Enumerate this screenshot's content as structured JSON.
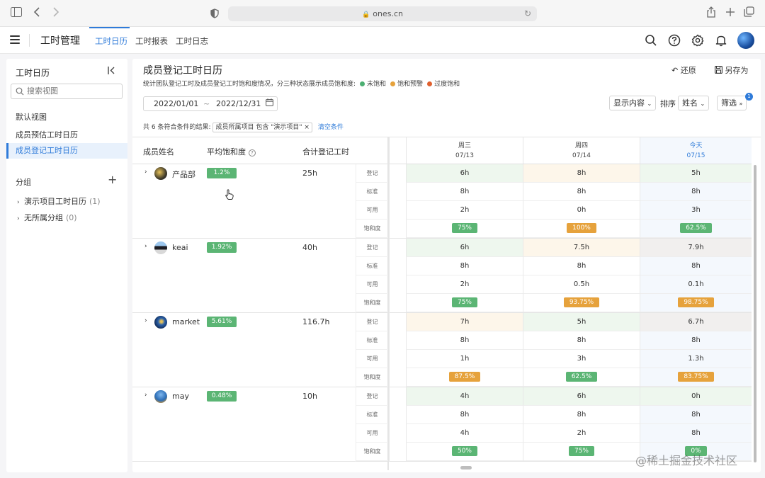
{
  "browser": {
    "url": "ones.cn"
  },
  "header": {
    "app_title": "工时管理",
    "tabs": [
      {
        "label": "工时日历",
        "active": true
      },
      {
        "label": "工时报表"
      },
      {
        "label": "工时日志"
      }
    ]
  },
  "sidebar": {
    "title": "工时日历",
    "search_placeholder": "搜索视图",
    "default_section": "默认视图",
    "views": [
      {
        "label": "成员预估工时日历"
      },
      {
        "label": "成员登记工时日历",
        "active": true
      }
    ],
    "group_section": "分组",
    "groups": [
      {
        "label": "演示项目工时日历",
        "count": "(1)"
      },
      {
        "label": "无所属分组",
        "count": "(0)"
      }
    ]
  },
  "main": {
    "title": "成员登记工时日历",
    "description": "统计团队登记工时及成员登记工时饱和度情况，分三种状态展示成员饱和度:",
    "legend": [
      {
        "label": "未饱和",
        "color": "#4caf72"
      },
      {
        "label": "饱和预警",
        "color": "#e6a23c"
      },
      {
        "label": "过度饱和",
        "color": "#e0602e"
      }
    ],
    "restore_label": "还原",
    "save_as_label": "另存为",
    "date_start": "2022/01/01",
    "date_sep": "~",
    "date_end": "2022/12/31",
    "display_label": "显示内容",
    "sort_label": "排序",
    "sort_value": "姓名",
    "filter_label": "筛选",
    "filter_badge": "1",
    "result_text": "共 6 条符合条件的结果:",
    "condition_tag": "成员所属项目 包含 \"演示项目\"",
    "clear_label": "清空条件"
  },
  "table": {
    "col_name": "成员姓名",
    "col_avg": "平均饱和度",
    "col_total": "合计登记工时",
    "row_labels": [
      "登记",
      "标准",
      "可用",
      "饱和度"
    ],
    "days": [
      {
        "weekday": "周三",
        "date": "07/13"
      },
      {
        "weekday": "周四",
        "date": "07/14"
      },
      {
        "weekday": "今天",
        "date": "07/15",
        "today": true
      }
    ],
    "members": [
      {
        "name": "产品部",
        "avg": "1.2%",
        "total": "25h",
        "caret": "›",
        "days": [
          {
            "logged": "6h",
            "standard": "8h",
            "available": "2h",
            "sat": "75%",
            "level": "g",
            "bg": "bg-g"
          },
          {
            "logged": "8h",
            "standard": "8h",
            "available": "0h",
            "sat": "100%",
            "level": "o",
            "bg": "bg-o"
          },
          {
            "logged": "5h",
            "standard": "8h",
            "available": "3h",
            "sat": "62.5%",
            "level": "g",
            "bg": "bg-g"
          }
        ]
      },
      {
        "name": "keai",
        "avg": "1.92%",
        "total": "40h",
        "caret": "›",
        "days": [
          {
            "logged": "6h",
            "standard": "8h",
            "available": "2h",
            "sat": "75%",
            "level": "g",
            "bg": "bg-g"
          },
          {
            "logged": "7.5h",
            "standard": "8h",
            "available": "0.5h",
            "sat": "93.75%",
            "level": "o",
            "bg": "bg-o"
          },
          {
            "logged": "7.9h",
            "standard": "8h",
            "available": "0.1h",
            "sat": "98.75%",
            "level": "o",
            "bg": "bg-gray"
          }
        ]
      },
      {
        "name": "market",
        "avg": "5.61%",
        "total": "116.7h",
        "caret": "›",
        "days": [
          {
            "logged": "7h",
            "standard": "8h",
            "available": "1h",
            "sat": "87.5%",
            "level": "o",
            "bg": "bg-o"
          },
          {
            "logged": "5h",
            "standard": "8h",
            "available": "3h",
            "sat": "62.5%",
            "level": "g",
            "bg": "bg-g"
          },
          {
            "logged": "6.7h",
            "standard": "8h",
            "available": "1.3h",
            "sat": "83.75%",
            "level": "o",
            "bg": "bg-gray"
          }
        ]
      },
      {
        "name": "may",
        "avg": "0.48%",
        "total": "10h",
        "caret": "›",
        "days": [
          {
            "logged": "4h",
            "standard": "8h",
            "available": "4h",
            "sat": "50%",
            "level": "g",
            "bg": "bg-g"
          },
          {
            "logged": "6h",
            "standard": "8h",
            "available": "2h",
            "sat": "75%",
            "level": "g",
            "bg": "bg-g"
          },
          {
            "logged": "0h",
            "standard": "8h",
            "available": "8h",
            "sat": "0%",
            "level": "g",
            "bg": "bg-g"
          }
        ]
      }
    ]
  },
  "watermark": "@稀土掘金技术社区"
}
